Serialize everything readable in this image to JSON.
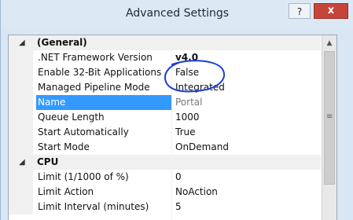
{
  "window": {
    "title": "Advanced Settings",
    "help_label": "?",
    "close_label": "x"
  },
  "grid": {
    "categories": [
      {
        "toggle": "◢",
        "label": "(General)"
      },
      {
        "toggle": "◢",
        "label": "CPU"
      }
    ],
    "general": [
      {
        "name": ".NET Framework Version",
        "value": "v4.0"
      },
      {
        "name": "Enable 32-Bit Applications",
        "value": "False"
      },
      {
        "name": "Managed Pipeline Mode",
        "value": "Integrated"
      },
      {
        "name": "Name",
        "value": "Portal"
      },
      {
        "name": "Queue Length",
        "value": "1000"
      },
      {
        "name": "Start Automatically",
        "value": "True"
      },
      {
        "name": "Start Mode",
        "value": "OnDemand"
      }
    ],
    "cpu": [
      {
        "name": "Limit (1/1000 of %)",
        "value": "0"
      },
      {
        "name": "Limit Action",
        "value": "NoAction"
      },
      {
        "name": "Limit Interval (minutes)",
        "value": "5"
      }
    ],
    "scroll_up_icon": "▲",
    "thumb_grip_icon": "≡",
    "annotation_color": "#1a3fd6",
    "selection_color": "#3399ff"
  }
}
